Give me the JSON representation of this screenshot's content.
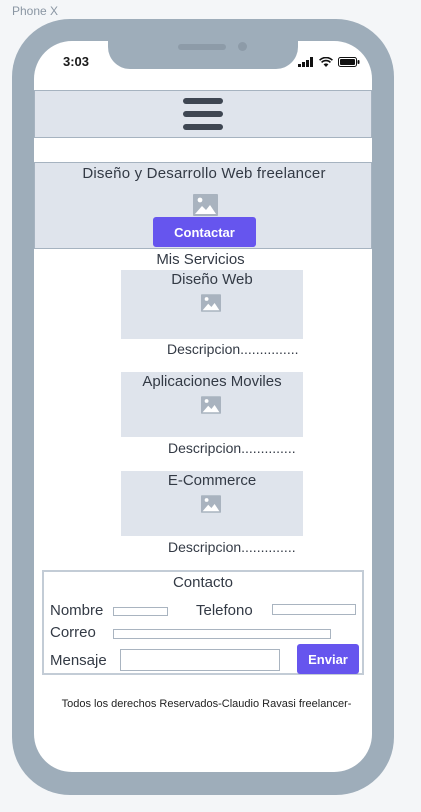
{
  "frame": {
    "label": "Phone X"
  },
  "status_bar": {
    "time": "3:03",
    "icons": [
      "signal-icon",
      "wifi-icon",
      "battery-icon"
    ]
  },
  "navbar": {
    "icon": "hamburger-menu-icon"
  },
  "hero": {
    "title": "Diseño y Desarrollo Web freelancer",
    "image_icon": "image-placeholder-icon",
    "button_label": "Contactar"
  },
  "services": {
    "title": "Mis Servicios",
    "items": [
      {
        "name": "Diseño Web",
        "description": "Descripcion..............."
      },
      {
        "name": "Aplicaciones Moviles",
        "description": "Descripcion.............."
      },
      {
        "name": "E-Commerce",
        "description": "Descripcion.............."
      }
    ]
  },
  "contact": {
    "title": "Contacto",
    "name_label": "Nombre",
    "phone_label": "Telefono",
    "email_label": "Correo",
    "message_label": "Mensaje",
    "name_value": "",
    "phone_value": "",
    "email_value": "",
    "message_value": "",
    "send_label": "Enviar"
  },
  "footer": {
    "text": "Todos los derechos Reservados-Claudio Ravasi freelancer-"
  },
  "colors": {
    "accent": "#6655ee",
    "placeholder_bg": "#dfe4ec",
    "phone_frame": "#9eadba"
  }
}
